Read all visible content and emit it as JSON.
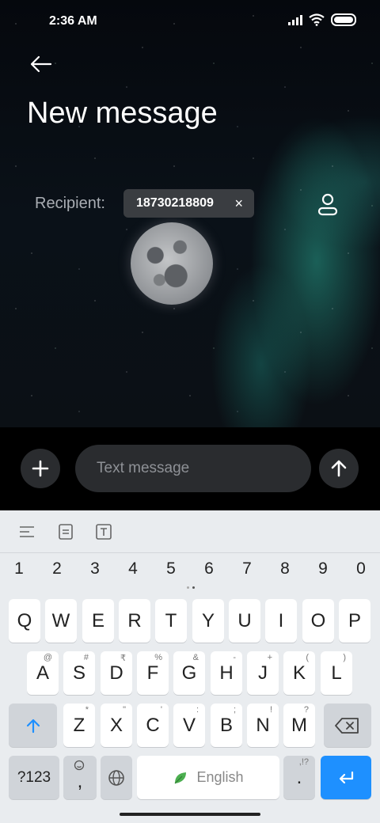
{
  "status_bar": {
    "time": "2:36 AM"
  },
  "header": {
    "title": "New message"
  },
  "recipient": {
    "label": "Recipient:",
    "chips": [
      {
        "number": "18730218809",
        "remove": "×"
      }
    ]
  },
  "compose": {
    "placeholder": "Text message"
  },
  "keyboard": {
    "number_row": [
      "1",
      "2",
      "3",
      "4",
      "5",
      "6",
      "7",
      "8",
      "9",
      "0"
    ],
    "row1": [
      {
        "k": "Q"
      },
      {
        "k": "W"
      },
      {
        "k": "E"
      },
      {
        "k": "R"
      },
      {
        "k": "T"
      },
      {
        "k": "Y"
      },
      {
        "k": "U"
      },
      {
        "k": "I"
      },
      {
        "k": "O"
      },
      {
        "k": "P"
      }
    ],
    "row2": [
      {
        "k": "A",
        "h": "@"
      },
      {
        "k": "S",
        "h": "#"
      },
      {
        "k": "D",
        "h": "₹"
      },
      {
        "k": "F",
        "h": "%"
      },
      {
        "k": "G",
        "h": "&"
      },
      {
        "k": "H",
        "h": "-"
      },
      {
        "k": "J",
        "h": "+"
      },
      {
        "k": "K",
        "h": "("
      },
      {
        "k": "L",
        "h": ")"
      }
    ],
    "row3": [
      {
        "k": "Z",
        "h": "*"
      },
      {
        "k": "X",
        "h": "\""
      },
      {
        "k": "C",
        "h": "'"
      },
      {
        "k": "V",
        "h": ":"
      },
      {
        "k": "B",
        "h": ";"
      },
      {
        "k": "N",
        "h": "!"
      },
      {
        "k": "M",
        "h": "?"
      }
    ],
    "symbols_label": "?123",
    "comma": ",",
    "space_label": "English",
    "period": ".",
    "period_hint": ",!?"
  },
  "colors": {
    "accent": "#1e90ff",
    "leaf": "#4caf50"
  }
}
